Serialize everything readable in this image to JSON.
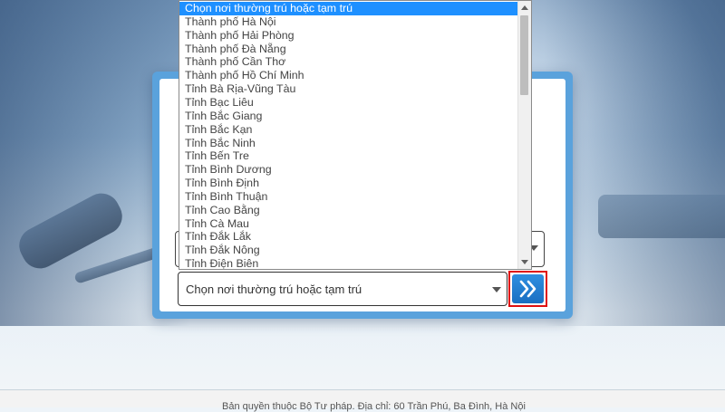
{
  "footer": {
    "text": "Bản quyền thuộc Bộ Tư pháp. Địa chỉ: 60 Trần Phú, Ba Đình, Hà Nội"
  },
  "form": {
    "residence_select": {
      "value": "Chọn nơi thường trú hoặc tạm trú"
    },
    "submit_icon": "double-chevron-right-icon"
  },
  "dropdown": {
    "options": [
      "Chọn nơi thường trú hoặc tạm trú",
      "Thành phố Hà Nội",
      "Thành phố Hải Phòng",
      "Thành phố Đà Nẵng",
      "Thành phố Cần Thơ",
      "Thành phố Hồ Chí Minh",
      "Tỉnh Bà Rịa-Vũng Tàu",
      "Tỉnh Bạc Liêu",
      "Tỉnh Bắc Giang",
      "Tỉnh Bắc Kạn",
      "Tỉnh Bắc Ninh",
      "Tỉnh Bến Tre",
      "Tỉnh Bình Dương",
      "Tỉnh Bình Định",
      "Tỉnh Bình Thuận",
      "Tỉnh Cao Bằng",
      "Tỉnh Cà Mau",
      "Tỉnh Đắk Lắk",
      "Tỉnh Đắk Nông",
      "Tỉnh Điện Biên"
    ],
    "selected_index": 0
  },
  "colors": {
    "selected_bg": "#1e90ff",
    "panel_border": "#5aa2dc",
    "submit_button": "#1a6fc2",
    "highlight_frame": "#e01010"
  }
}
